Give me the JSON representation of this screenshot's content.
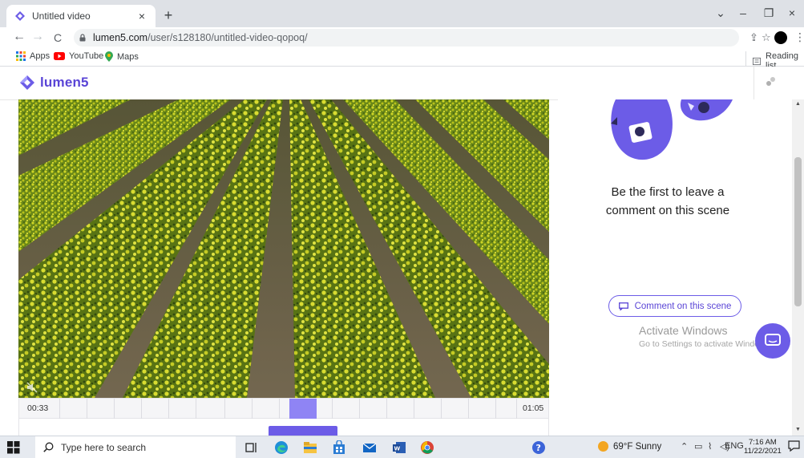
{
  "browser": {
    "tab_title": "Untitled video",
    "tab_close": "×",
    "new_tab": "+",
    "window_controls": {
      "minimize": "–",
      "restore": "❐",
      "close": "×",
      "dropdown": "⌄"
    },
    "nav": {
      "back": "←",
      "forward": "→",
      "reload": "C"
    },
    "url_host": "lumen5.com",
    "url_path": "/user/s128180/untitled-video-qopoq/",
    "bookmarks": [
      {
        "label": "Apps",
        "icon": "apps-grid-icon"
      },
      {
        "label": "YouTube",
        "icon": "youtube-icon"
      },
      {
        "label": "Maps",
        "icon": "maps-icon"
      }
    ],
    "reading_list": "Reading list"
  },
  "app": {
    "logo_text": "lumen5",
    "accent_color": "#6c5ce7"
  },
  "timeline": {
    "start_time": "00:33",
    "end_time": "01:05"
  },
  "side_panel": {
    "empty_line1": "Be the first to leave a",
    "empty_line2": "comment on this scene",
    "comment_button": "Comment on this scene"
  },
  "watermark": {
    "line1": "Activate Windows",
    "line2": "Go to Settings to activate Windows."
  },
  "taskbar": {
    "search_placeholder": "Type here to search",
    "weather": "69°F  Sunny",
    "language": "ENG",
    "time": "7:16 AM",
    "date": "11/22/2021"
  }
}
